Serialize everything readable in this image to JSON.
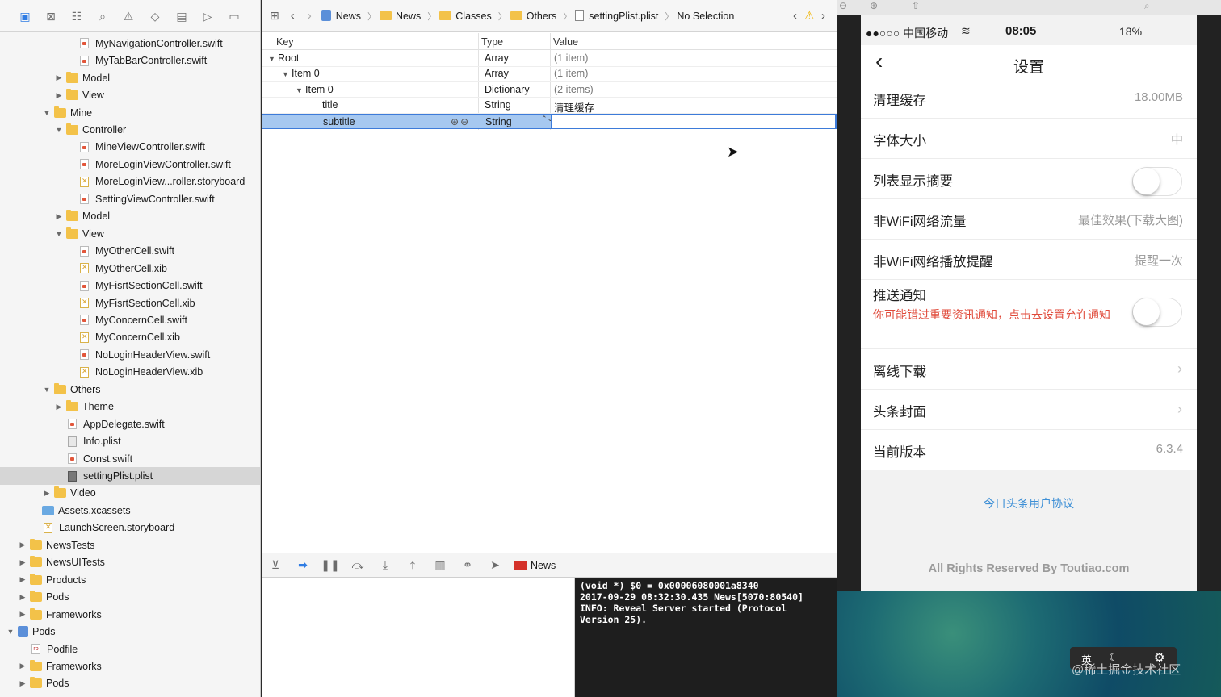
{
  "navigator": {
    "tabs": [
      "project-navigator",
      "symbol-navigator",
      "find-navigator",
      "issue-navigator",
      "test-navigator",
      "debug-navigator",
      "breakpoint-navigator",
      "report-navigator"
    ],
    "rows": [
      {
        "label": "MyNavigationController.swift",
        "icon": "swift",
        "level": 6,
        "disc": ""
      },
      {
        "label": "MyTabBarController.swift",
        "icon": "swift",
        "level": 6,
        "disc": ""
      },
      {
        "label": "Model",
        "icon": "folder",
        "level": 5,
        "disc": "closed"
      },
      {
        "label": "View",
        "icon": "folder",
        "level": 5,
        "disc": "closed"
      },
      {
        "label": "Mine",
        "icon": "folder",
        "level": 4,
        "disc": "open"
      },
      {
        "label": "Controller",
        "icon": "folder",
        "level": 5,
        "disc": "open"
      },
      {
        "label": "MineViewController.swift",
        "icon": "swift",
        "level": 6,
        "disc": ""
      },
      {
        "label": "MoreLoginViewController.swift",
        "icon": "swift",
        "level": 6,
        "disc": ""
      },
      {
        "label": "MoreLoginView...roller.storyboard",
        "icon": "xib",
        "level": 6,
        "disc": ""
      },
      {
        "label": "SettingViewController.swift",
        "icon": "swift",
        "level": 6,
        "disc": ""
      },
      {
        "label": "Model",
        "icon": "folder",
        "level": 5,
        "disc": "closed"
      },
      {
        "label": "View",
        "icon": "folder",
        "level": 5,
        "disc": "open"
      },
      {
        "label": "MyOtherCell.swift",
        "icon": "swift",
        "level": 6,
        "disc": ""
      },
      {
        "label": "MyOtherCell.xib",
        "icon": "xib",
        "level": 6,
        "disc": ""
      },
      {
        "label": "MyFisrtSectionCell.swift",
        "icon": "swift",
        "level": 6,
        "disc": ""
      },
      {
        "label": "MyFisrtSectionCell.xib",
        "icon": "xib",
        "level": 6,
        "disc": ""
      },
      {
        "label": "MyConcernCell.swift",
        "icon": "swift",
        "level": 6,
        "disc": ""
      },
      {
        "label": "MyConcernCell.xib",
        "icon": "xib",
        "level": 6,
        "disc": ""
      },
      {
        "label": "NoLoginHeaderView.swift",
        "icon": "swift",
        "level": 6,
        "disc": ""
      },
      {
        "label": "NoLoginHeaderView.xib",
        "icon": "xib",
        "level": 6,
        "disc": ""
      },
      {
        "label": "Others",
        "icon": "folder",
        "level": 4,
        "disc": "open"
      },
      {
        "label": "Theme",
        "icon": "folder",
        "level": 5,
        "disc": "closed"
      },
      {
        "label": "AppDelegate.swift",
        "icon": "swift",
        "level": 5,
        "disc": ""
      },
      {
        "label": "Info.plist",
        "icon": "plist",
        "level": 5,
        "disc": ""
      },
      {
        "label": "Const.swift",
        "icon": "swift",
        "level": 5,
        "disc": ""
      },
      {
        "label": "settingPlist.plist",
        "icon": "plist-dark",
        "level": 5,
        "disc": "",
        "selected": true
      },
      {
        "label": "Video",
        "icon": "folder",
        "level": 4,
        "disc": "closed"
      },
      {
        "label": "Assets.xcassets",
        "icon": "assets",
        "level": 3,
        "disc": ""
      },
      {
        "label": "LaunchScreen.storyboard",
        "icon": "xib",
        "level": 3,
        "disc": ""
      },
      {
        "label": "NewsTests",
        "icon": "folder",
        "level": 2,
        "disc": "closed"
      },
      {
        "label": "NewsUITests",
        "icon": "folder",
        "level": 2,
        "disc": "closed"
      },
      {
        "label": "Products",
        "icon": "folder",
        "level": 2,
        "disc": "closed"
      },
      {
        "label": "Pods",
        "icon": "folder",
        "level": 2,
        "disc": "closed"
      },
      {
        "label": "Frameworks",
        "icon": "folder",
        "level": 2,
        "disc": "closed"
      },
      {
        "label": "Pods",
        "icon": "project",
        "level": 1,
        "disc": "open"
      },
      {
        "label": "Podfile",
        "icon": "rb",
        "level": 2,
        "disc": ""
      },
      {
        "label": "Frameworks",
        "icon": "folder",
        "level": 2,
        "disc": "closed"
      },
      {
        "label": "Pods",
        "icon": "folder",
        "level": 2,
        "disc": "closed"
      }
    ]
  },
  "jumpbar": {
    "crumbs": [
      "News",
      "News",
      "Classes",
      "Others",
      "settingPlist.plist",
      "No Selection"
    ]
  },
  "plist": {
    "headers": {
      "key": "Key",
      "type": "Type",
      "value": "Value"
    },
    "rows": [
      {
        "key": "Root",
        "type": "Array",
        "value": "(1 item)",
        "indent": 0,
        "disc": "▼",
        "gray": true
      },
      {
        "key": "Item 0",
        "type": "Array",
        "value": "(1 item)",
        "indent": 1,
        "disc": "▼",
        "gray": true
      },
      {
        "key": "Item 0",
        "type": "Dictionary",
        "value": "(2 items)",
        "indent": 2,
        "disc": "▼",
        "gray": true
      },
      {
        "key": "title",
        "type": "String",
        "value": "清理缓存",
        "indent": 3,
        "disc": "",
        "gray": false
      },
      {
        "key": "subtitle",
        "type": "String",
        "value": "",
        "indent": 3,
        "disc": "",
        "gray": false,
        "selected": true
      }
    ]
  },
  "debug": {
    "scheme_label": "News",
    "console_lines": [
      "(void *) $0 = 0x00006080001a8340",
      "2017-09-29 08:32:30.435 News[5070:80540]",
      "INFO: Reveal Server started (Protocol",
      "Version 25)."
    ]
  },
  "phone": {
    "carrier": "●●○○○ 中国移动",
    "time": "08:05",
    "battery": "18%",
    "title": "设置",
    "rows": [
      {
        "label": "清理缓存",
        "value": "18.00MB",
        "kind": "value"
      },
      {
        "label": "字体大小",
        "value": "中",
        "kind": "value"
      },
      {
        "label": "列表显示摘要",
        "value": "",
        "kind": "toggle"
      },
      {
        "label": "非WiFi网络流量",
        "value": "最佳效果(下载大图)",
        "kind": "value"
      },
      {
        "label": "非WiFi网络播放提醒",
        "value": "提醒一次",
        "kind": "value"
      },
      {
        "label": "推送通知",
        "value": "",
        "kind": "toggle-note",
        "note": "你可能错过重要资讯通知，点击去设置允许通知"
      },
      {
        "label": "离线下载",
        "value": "",
        "kind": "chevron"
      },
      {
        "label": "头条封面",
        "value": "",
        "kind": "chevron"
      },
      {
        "label": "当前版本",
        "value": "6.3.4",
        "kind": "value"
      }
    ],
    "agreement_link": "今日头条用户协议",
    "footer": "All Rights Reserved By Toutiao.com",
    "watermark": "@稀土掘金技术社区",
    "ime_label": "英"
  },
  "colors": {
    "selection": "#a6c8f0",
    "accent": "#2f7ce3",
    "link": "#3d8fd6",
    "warning": "#f0b400",
    "note_red": "#e04a3a"
  }
}
